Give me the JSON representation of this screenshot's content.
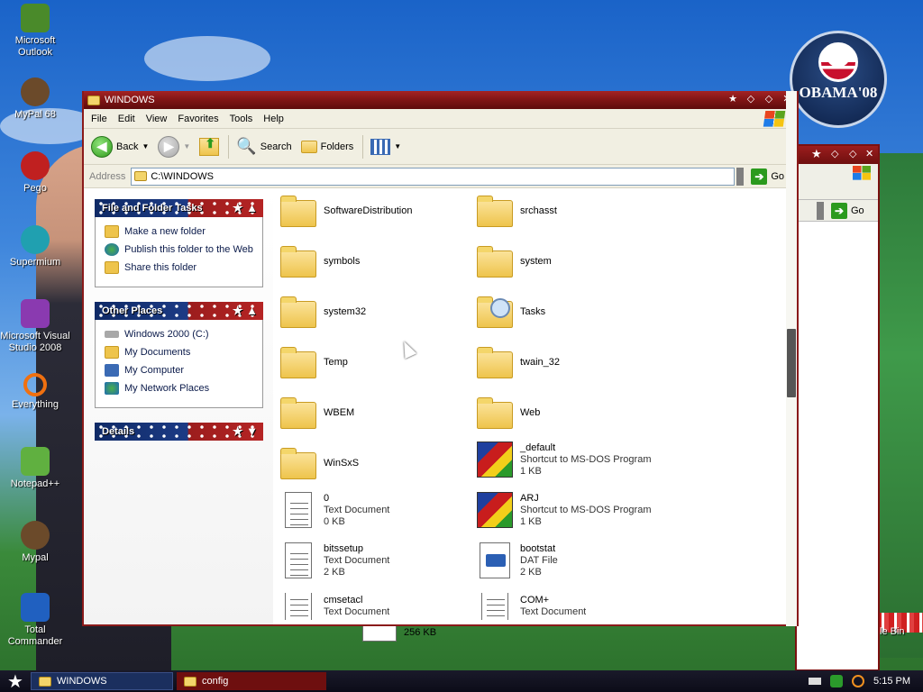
{
  "desktop": {
    "icons": [
      {
        "label": "Microsoft Outlook",
        "color": "#4a8a2a"
      },
      {
        "label": "MyPal 68",
        "color": "#6b4a2a"
      },
      {
        "label": "Pego",
        "color": "#c02020"
      },
      {
        "label": "Supermium",
        "color": "#20a0b0"
      },
      {
        "label": "Microsoft Visual Studio 2008",
        "color": "#8a3ab0"
      },
      {
        "label": "Everything",
        "color": "#f07010"
      },
      {
        "label": "Notepad++",
        "color": "#60b040"
      },
      {
        "label": "Mypal",
        "color": "#6b4a2a"
      },
      {
        "label": "Total Commander",
        "color": "#2060c0"
      }
    ],
    "badge_text": "OBAMA'08",
    "recycle_bin_partial": "le Bin",
    "background_file_size": "256 KB"
  },
  "window": {
    "title": "WINDOWS",
    "menu": [
      "File",
      "Edit",
      "View",
      "Favorites",
      "Tools",
      "Help"
    ],
    "toolbar": {
      "back": "Back",
      "search": "Search",
      "folders": "Folders"
    },
    "address": {
      "label": "Address",
      "value": "C:\\WINDOWS",
      "go": "Go"
    }
  },
  "back_window": {
    "go": "Go"
  },
  "tasks": {
    "file_folder": {
      "title": "File and Folder Tasks",
      "items": [
        "Make a new folder",
        "Publish this folder to the Web",
        "Share this folder"
      ]
    },
    "other_places": {
      "title": "Other Places",
      "items": [
        "Windows 2000 (C:)",
        "My Documents",
        "My Computer",
        "My Network Places"
      ]
    },
    "details": {
      "title": "Details"
    }
  },
  "files": [
    {
      "name": "SoftwareDistribution",
      "type": "",
      "size": "",
      "icon": "folder-icon"
    },
    {
      "name": "srchasst",
      "type": "",
      "size": "",
      "icon": "folder-icon"
    },
    {
      "name": "symbols",
      "type": "",
      "size": "",
      "icon": "folder-icon"
    },
    {
      "name": "system",
      "type": "",
      "size": "",
      "icon": "folder-icon"
    },
    {
      "name": "system32",
      "type": "",
      "size": "",
      "icon": "folder-icon"
    },
    {
      "name": "Tasks",
      "type": "",
      "size": "",
      "icon": "scheduled-tasks-icon"
    },
    {
      "name": "Temp",
      "type": "",
      "size": "",
      "icon": "folder-icon"
    },
    {
      "name": "twain_32",
      "type": "",
      "size": "",
      "icon": "folder-icon"
    },
    {
      "name": "WBEM",
      "type": "",
      "size": "",
      "icon": "folder-icon"
    },
    {
      "name": "Web",
      "type": "",
      "size": "",
      "icon": "folder-icon"
    },
    {
      "name": "WinSxS",
      "type": "",
      "size": "",
      "icon": "folder-icon"
    },
    {
      "name": "_default",
      "type": "Shortcut to MS-DOS Program",
      "size": "1 KB",
      "icon": "msdos-shortcut-icon"
    },
    {
      "name": "0",
      "type": "Text Document",
      "size": "0 KB",
      "icon": "text-document-icon"
    },
    {
      "name": "ARJ",
      "type": "Shortcut to MS-DOS Program",
      "size": "1 KB",
      "icon": "msdos-shortcut-icon"
    },
    {
      "name": "bitssetup",
      "type": "Text Document",
      "size": "2 KB",
      "icon": "text-document-icon"
    },
    {
      "name": "bootstat",
      "type": "DAT File",
      "size": "2 KB",
      "icon": "dat-file-icon"
    },
    {
      "name": "cmsetacl",
      "type": "Text Document",
      "size": "",
      "icon": "text-document-icon"
    },
    {
      "name": "COM+",
      "type": "Text Document",
      "size": "",
      "icon": "text-document-icon"
    }
  ],
  "taskbar": {
    "tasks": [
      "WINDOWS",
      "config"
    ],
    "clock": "5:15 PM"
  }
}
